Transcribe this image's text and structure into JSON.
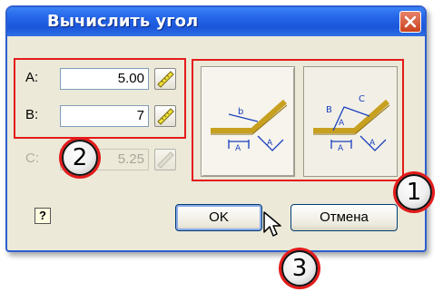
{
  "dialog": {
    "title": "Вычислить угол",
    "fields": [
      {
        "label": "A:",
        "value": "5.00",
        "enabled": true
      },
      {
        "label": "B:",
        "value": "7",
        "enabled": true
      },
      {
        "label": "C:",
        "value": "5.25",
        "enabled": false
      }
    ],
    "modes": [
      {
        "name": "two-sides",
        "selected": true,
        "labels": [
          "b",
          "A",
          "A"
        ]
      },
      {
        "name": "three-sides",
        "selected": false,
        "labels": [
          "B",
          "C",
          "A",
          "A",
          "A"
        ]
      }
    ],
    "ok_label": "OK",
    "cancel_label": "Отмена",
    "help_label": "?"
  },
  "callouts": [
    "1",
    "2",
    "3"
  ],
  "colors": {
    "title_bar": "#2566e8",
    "highlight": "#e41b1b",
    "close": "#c9421d"
  }
}
